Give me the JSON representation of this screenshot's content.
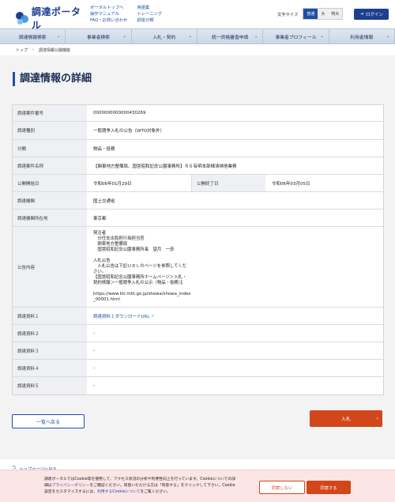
{
  "header": {
    "logo_text": "調達ポータル",
    "links_col1": [
      "ポータルトップへ",
      "操作マニュアル",
      "FAQ・お問い合わせ"
    ],
    "links_col2": [
      "用語集",
      "トレーニング",
      "調達分類"
    ],
    "font_size_label": "文字サイズ",
    "font_sizes": [
      "普通",
      "大",
      "特大"
    ],
    "login": "ログイン"
  },
  "nav": [
    "調達情報検索",
    "事業者検索",
    "入札・契約",
    "統一資格審査申請",
    "事業者プロフィール",
    "利用者情報"
  ],
  "breadcrumb": [
    "トップ",
    "調達情報公開機能"
  ],
  "page_title": "調達情報の詳細",
  "details": {
    "case_no_label": "調達案件番号",
    "case_no": "0000000000000430269",
    "type_label": "調達種別",
    "type": "一般競争入札の公告（WTO対象外）",
    "category_label": "分類",
    "category": "物品・役務",
    "name_label": "調達案件名称",
    "name": "【関東地方整備局、国営昭和記念公園事務所】Ｒ６有明本部棟清掃他業務",
    "start_label": "公開開始日",
    "start": "令和06年01月29日",
    "end_label": "公開終了日",
    "end": "令和06年03月05日",
    "org_label": "調達機関",
    "org": "国土交通省",
    "location_label": "調達機関所在地",
    "location": "東京都",
    "content_label": "公告内容",
    "content": "発注者\n　分任支出負担行為担当官\n　関東地方整備局\n　国営昭和記念公園事務所長　望月　一彦\n\n入札公告\n　入札公告は下記ＵＲＬのページを参照してくだ\nさい。\n【国営昭和記念公園事務所ホームページ＞入札・\n契約情報＞一般競争入札の公示（物品・役務）】\n\nhttps://www.ktr.mlit.go.jp/showa/showa_index\n_00001.html",
    "doc1_label": "調達資料１",
    "doc1": "調達資料１ダウンロードURL",
    "doc2_label": "調達資料２",
    "doc2": "-",
    "doc3_label": "調達資料３",
    "doc3": "-",
    "doc4_label": "調達資料４",
    "doc4": "-",
    "doc5_label": "調達資料５",
    "doc5": "-"
  },
  "buttons": {
    "back": "一覧へ戻る",
    "bid": "入札",
    "to_top": "トップページへ戻る"
  },
  "cookie": {
    "text1": "調達ポータルではCookie等を使用して、アクセス状況の分析や利便性向上を行っています。Cookieについての詳",
    "text2a": "細は",
    "policy": "プライバシーポリシー",
    "text2b": "をご確認ください。同意いただける方は「同意する」をクリックして下さい。Cookie",
    "text3a": "設定をカスタマイズするには、",
    "cookie_link": "利用するCookieについて",
    "text3b": "をご覧ください。",
    "decline": "同意しない",
    "accept": "同意する"
  },
  "colors": {
    "primary": "#1d4fa8",
    "accent": "#d2461b",
    "cookie_bg": "#fbe5e5"
  }
}
